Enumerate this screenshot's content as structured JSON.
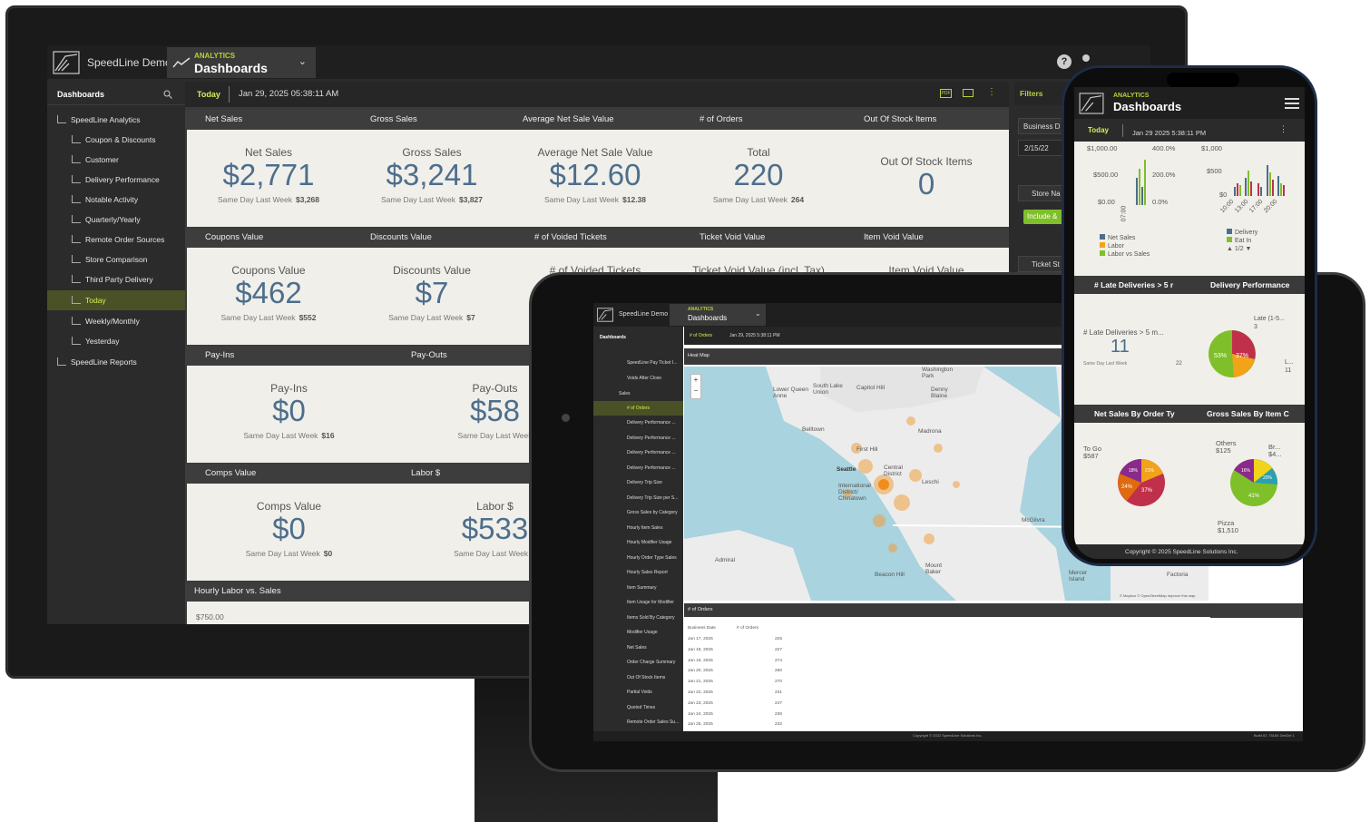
{
  "desktop": {
    "app_name": "SpeedLine Demo",
    "tab_small": "ANALYTICS",
    "tab_title": "Dashboards",
    "sidebar_title": "Dashboards",
    "sidebar_group": "SpeedLine Analytics",
    "sidebar_items": [
      "Coupon & Discounts",
      "Customer",
      "Delivery Performance",
      "Notable Activity",
      "Quarterly/Yearly",
      "Remote Order Sources",
      "Store Comparison",
      "Third Party Delivery",
      "Today",
      "Weekly/Monthly",
      "Yesterday"
    ],
    "sidebar_reports": "SpeedLine Reports",
    "date_tab": "Today",
    "date_text": "Jan 29, 2025 05:38:11 AM",
    "row1_headers": [
      "Net Sales",
      "Gross Sales",
      "Average Net Sale Value",
      "# of Orders",
      "Out Of Stock Items"
    ],
    "row1_kpis": [
      {
        "title": "Net Sales",
        "value": "$2,771",
        "sub": "Same Day Last Week",
        "prev": "$3,268"
      },
      {
        "title": "Gross Sales",
        "value": "$3,241",
        "sub": "Same Day Last Week",
        "prev": "$3,827"
      },
      {
        "title": "Average Net Sale Value",
        "value": "$12.60",
        "sub": "Same Day Last Week",
        "prev": "$12.38"
      },
      {
        "title": "Total",
        "value": "220",
        "sub": "Same Day Last Week",
        "prev": "264"
      },
      {
        "title": "Out Of Stock Items",
        "value": "0"
      }
    ],
    "row2_headers": [
      "Coupons Value",
      "Discounts Value",
      "# of Voided Tickets",
      "Ticket Void Value",
      "Item Void Value"
    ],
    "row2_kpis": [
      {
        "title": "Coupons Value",
        "value": "$462",
        "sub": "Same Day Last Week",
        "prev": "$552"
      },
      {
        "title": "Discounts Value",
        "value": "$7",
        "sub": "Same Day Last Week",
        "prev": "$7"
      }
    ],
    "row2_partial": [
      "# of Voided Tickets",
      "Ticket Void Value (incl. Tax)",
      "Item Void Value"
    ],
    "row3_headers": [
      "Pay-Ins",
      "Pay-Outs"
    ],
    "row3_kpis": [
      {
        "title": "Pay-Ins",
        "value": "$0",
        "sub": "Same Day Last Week",
        "prev": "$16"
      },
      {
        "title": "Pay-Outs",
        "value": "$58",
        "sub": "Same Day Last Week",
        "prev": ""
      }
    ],
    "row4_headers": [
      "Comps Value",
      "Labor $"
    ],
    "row4_kpis": [
      {
        "title": "Comps Value",
        "value": "$0",
        "sub": "Same Day Last Week",
        "prev": "$0"
      },
      {
        "title": "Labor $",
        "value": "$533",
        "sub": "Same Day Last Week",
        "prev": "$"
      }
    ],
    "chart_header": "Hourly Labor vs. Sales",
    "chart_tick": "$750.00",
    "filters_title": "Filters",
    "filters": [
      "Business D",
      "2/15/22",
      "Store Na",
      "Include &",
      "Ticket St"
    ]
  },
  "tablet": {
    "app_name": "SpeedLine Demo",
    "tab_small": "ANALYTICS",
    "tab_title": "Dashboards",
    "sidebar_title": "Dashboards",
    "crumb": "# of Orders",
    "date": "Jan 29, 2025 5:38:11 PM",
    "items_top": [
      "SpeedLine Pay Ticket I...",
      "Voids After Close"
    ],
    "group": "Sales",
    "items": [
      "# of Orders",
      "Delivery Performance ...",
      "Delivery Performance ...",
      "Delivery Performance ...",
      "Delivery Performance ...",
      "Delivery Trip Size",
      "Delivery Trip Size per S...",
      "Gross Sales by Category",
      "Hourly Item Sales",
      "Hourly Modifier Usage",
      "Hourly Order Type Sales",
      "Hourly Sales Report",
      "Item Summary",
      "Item Usage for Modifier",
      "Items Sold By Category",
      "Modifier Usage",
      "Net Sales",
      "Order Charge Summary",
      "Out Of Stock Items",
      "Partial Voids",
      "Quoted Times",
      "Remote Order Sales Su..."
    ],
    "map_title": "Heat Map",
    "map_labels": [
      "Washington Park",
      "Lower Queen Anne",
      "South Lake Union",
      "Capitol Hill",
      "Denny Blaine",
      "Belltown",
      "Madrona",
      "First Hill",
      "Seattle",
      "Central District",
      "International District/ Chinatown",
      "Leschi",
      "McGilvra",
      "Admiral",
      "Beacon Hill",
      "Mount Baker",
      "Mercer Island",
      "Factoria"
    ],
    "map_credit": "© Mapbox © OpenStreetMap Improve this map",
    "table_title": "# of Orders",
    "table_cols": [
      "Business Date",
      "# of Orders"
    ],
    "table_rows": [
      [
        "Jan 17, 2025",
        "225"
      ],
      [
        "Jan 18, 2025",
        "227"
      ],
      [
        "Jan 19, 2025",
        "274"
      ],
      [
        "Jan 20, 2025",
        "250"
      ],
      [
        "Jan 21, 2025",
        "270"
      ],
      [
        "Jan 22, 2025",
        "231"
      ],
      [
        "Jan 23, 2025",
        "247"
      ],
      [
        "Jan 24, 2025",
        "236"
      ],
      [
        "Jan 25, 2025",
        "232"
      ]
    ],
    "footer": "Copyright © 2022 SpeedLine Solutions Inc.",
    "build": "Build ID: 75160 ZenDel 1"
  },
  "phone": {
    "tab_small": "ANALYTICS",
    "tab_title": "Dashboards",
    "today": "Today",
    "date": "Jan 29 2025 5:38:11 PM",
    "chart1_ticks": [
      "$1,000.00",
      "$500.00",
      "$0.00"
    ],
    "chart1_ticks2": [
      "400.0%",
      "200.0%",
      "0.0%"
    ],
    "chart1_xtick": "07:00",
    "chart1_legend": [
      "Net Sales",
      "Labor",
      "Labor vs Sales"
    ],
    "chart2_ticks": [
      "$1,000",
      "$500",
      "$0"
    ],
    "chart2_xticks": [
      "10:00",
      "13:00",
      "17:00",
      "20:00"
    ],
    "chart2_legend": [
      "Delivery",
      "Eat In"
    ],
    "chart2_pager": "1/2",
    "hdr2": [
      "# Late Deliveries > 5 r",
      "Delivery Performance"
    ],
    "late_title": "# Late Deliveries > 5 m...",
    "late_value": "11",
    "late_sub": "Same Day Last Week",
    "late_prev": "22",
    "pie1": {
      "labels": [
        "Late (1-5...",
        "3",
        "L...",
        "11"
      ],
      "pcts": [
        "53%",
        "37%"
      ]
    },
    "hdr3": [
      "Net Sales By Order Ty",
      "Gross Sales By Item C"
    ],
    "pie2": {
      "label1": "To Go",
      "label1v": "$587",
      "pcts": [
        "18%",
        "21%",
        "24%",
        "37%"
      ]
    },
    "pie3": {
      "label1": "Others",
      "label1v": "$125",
      "label2": "Br...",
      "label2v": "$4...",
      "label3": "Pizza",
      "label3v": "$1,510",
      "pcts": [
        "16%",
        "20%",
        "41%"
      ]
    },
    "footer": "Copyright © 2025 SpeedLine Solutions Inc."
  },
  "colors": {
    "accent": "#b5d334",
    "value_blue": "#4d6e8c",
    "header": "#3d3d3d",
    "card": "#f0efea"
  }
}
